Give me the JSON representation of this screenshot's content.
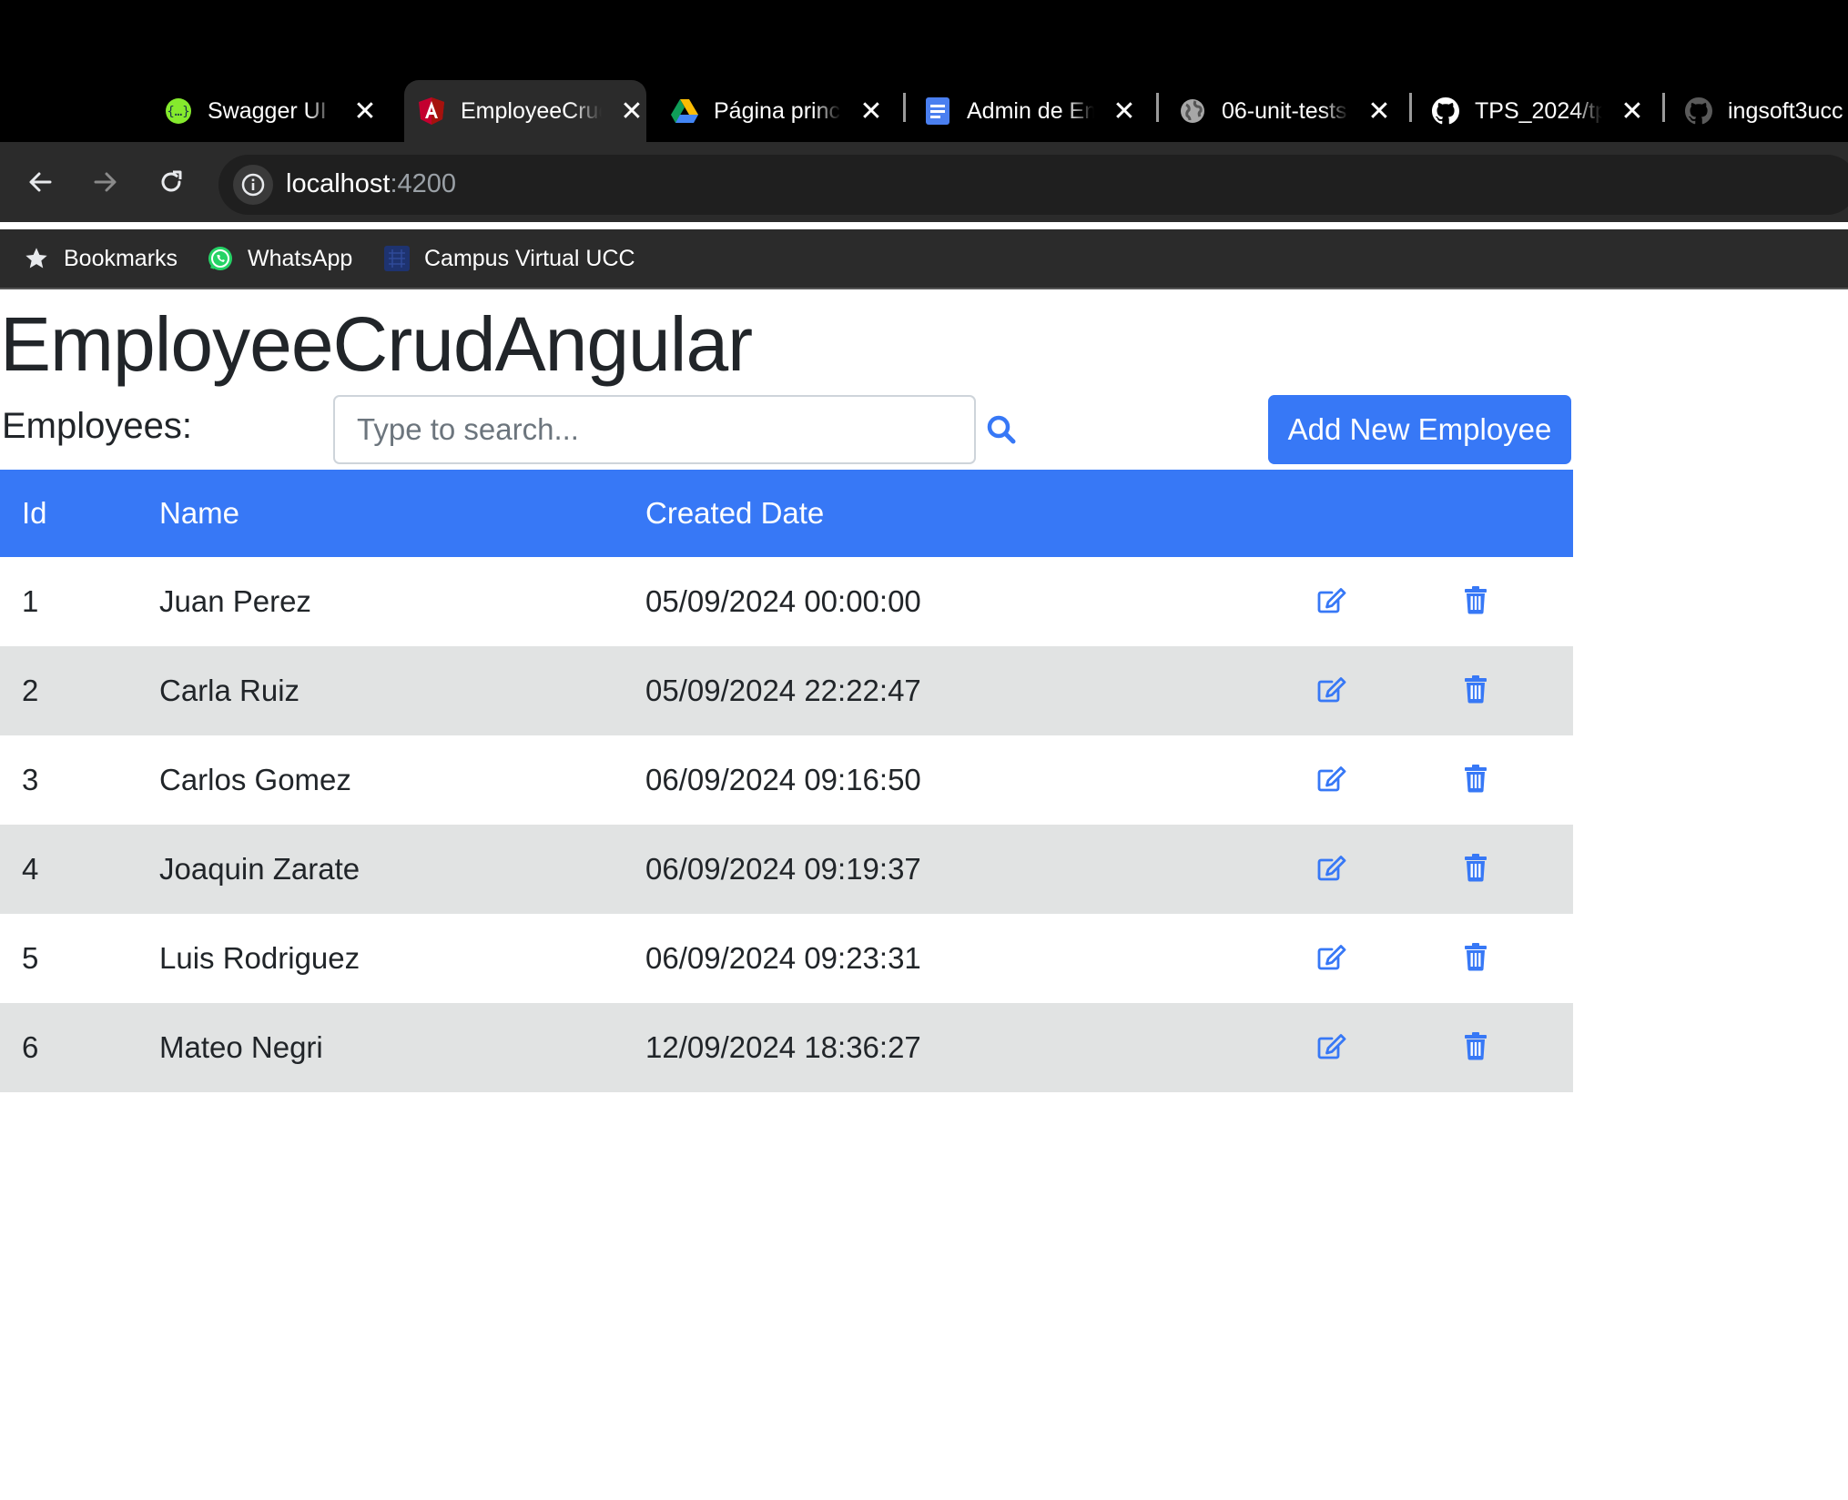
{
  "browser": {
    "tabs": [
      {
        "title": "Swagger UI",
        "icon": "swagger-icon",
        "active": false
      },
      {
        "title": "EmployeeCrudAngular",
        "icon": "angular-icon",
        "active": true
      },
      {
        "title": "Página principal",
        "icon": "google-drive-icon",
        "active": false
      },
      {
        "title": "Admin de Empleados",
        "icon": "google-docs-icon",
        "active": false
      },
      {
        "title": "06-unit-tests",
        "icon": "globe-icon",
        "active": false
      },
      {
        "title": "TPS_2024/tp",
        "icon": "github-icon",
        "active": false
      },
      {
        "title": "ingsoft3ucc",
        "icon": "github-icon",
        "active": false
      }
    ],
    "tab_close_glyph": "✕",
    "address": {
      "host": "localhost",
      "port": ":4200"
    },
    "bookmarks": [
      {
        "label": "Bookmarks",
        "icon": "star-icon"
      },
      {
        "label": "WhatsApp",
        "icon": "whatsapp-icon"
      },
      {
        "label": "Campus Virtual UCC",
        "icon": "campus-icon"
      }
    ]
  },
  "app": {
    "title": "EmployeeCrudAngular",
    "employees_label": "Employees:",
    "search_placeholder": "Type to search...",
    "add_button": "Add New Employee",
    "accent_color": "#3778f6",
    "table": {
      "headers": [
        "Id",
        "Name",
        "Created Date",
        "",
        ""
      ],
      "rows": [
        {
          "id": "1",
          "name": "Juan Perez",
          "created": "05/09/2024 00:00:00"
        },
        {
          "id": "2",
          "name": "Carla Ruiz",
          "created": "05/09/2024 22:22:47"
        },
        {
          "id": "3",
          "name": "Carlos Gomez",
          "created": "06/09/2024 09:16:50"
        },
        {
          "id": "4",
          "name": "Joaquin Zarate",
          "created": "06/09/2024 09:19:37"
        },
        {
          "id": "5",
          "name": "Luis Rodriguez",
          "created": "06/09/2024 09:23:31"
        },
        {
          "id": "6",
          "name": "Mateo Negri",
          "created": "12/09/2024 18:36:27"
        }
      ]
    }
  }
}
